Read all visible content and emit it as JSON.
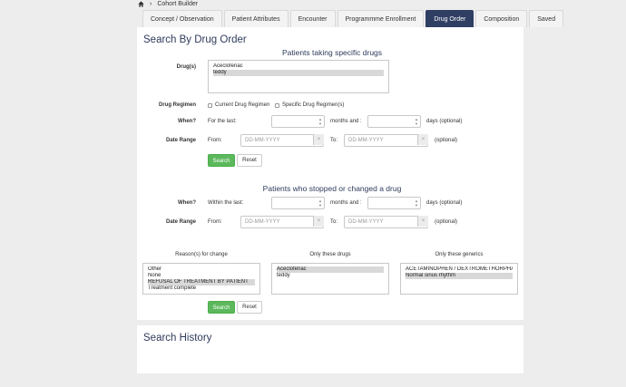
{
  "breadcrumb": {
    "home_icon": "home-icon",
    "separator": "›",
    "current": "Cohort Builder"
  },
  "tabs": [
    {
      "label": "Concept / Observation",
      "active": false
    },
    {
      "label": "Patient Attributes",
      "active": false
    },
    {
      "label": "Encounter",
      "active": false
    },
    {
      "label": "Programmme Enrollment",
      "active": false
    },
    {
      "label": "Drug Order",
      "active": true
    },
    {
      "label": "Composition",
      "active": false
    },
    {
      "label": "Saved",
      "active": false
    }
  ],
  "main": {
    "title": "Search By Drug Order",
    "specific": {
      "heading": "Patients taking specific drugs",
      "drugs_label": "Drug(s)",
      "drugs": [
        {
          "label": "Aceclofenac",
          "selected": false
        },
        {
          "label": "teddy",
          "selected": true
        }
      ],
      "regimen_label": "Drug Regimen",
      "regimen_current": "Current Drug Regimen",
      "regimen_specific": "Specific Drug Regimen(s)",
      "when_label": "When?",
      "for_last": "For the last:",
      "months_and": "months and :",
      "days_optional": "days (optional)",
      "date_range_label": "Date Range",
      "from": "From:",
      "to": "To:",
      "date_placeholder": "DD-MM-YYYY",
      "clear": "×",
      "optional": "(optional)",
      "search": "Search",
      "reset": "Reset"
    },
    "stopped": {
      "heading": "Patients who stopped or changed a drug",
      "when_label": "When?",
      "within_last": "Within the last:",
      "months_and": "months and :",
      "days_optional": "days (optional)",
      "date_range_label": "Date Range",
      "from": "From:",
      "to": "To:",
      "date_placeholder": "DD-MM-YYYY",
      "clear": "×",
      "optional": "(optional)",
      "reasons_heading": "Reason(s) for change",
      "reasons": [
        {
          "label": "Other",
          "selected": false
        },
        {
          "label": "None",
          "selected": false
        },
        {
          "label": "REFUSAL OF TREATMENT BY PATIENT",
          "selected": true
        },
        {
          "label": "Treatment complete",
          "selected": false
        }
      ],
      "drugs_heading": "Only these drugs",
      "drugs": [
        {
          "label": "Aceclofenac",
          "selected": true
        },
        {
          "label": "teddy",
          "selected": false
        }
      ],
      "generics_heading": "Only these generics",
      "generics": [
        {
          "label": "ACETAMINOPHEN / DEXTROMETHORPHAN",
          "selected": false
        },
        {
          "label": "Normal sinus rhythm",
          "selected": true
        }
      ],
      "search": "Search",
      "reset": "Reset"
    }
  },
  "history": {
    "title": "Search History"
  },
  "colors": {
    "accent": "#2f3e63",
    "success": "#5cb85c"
  }
}
